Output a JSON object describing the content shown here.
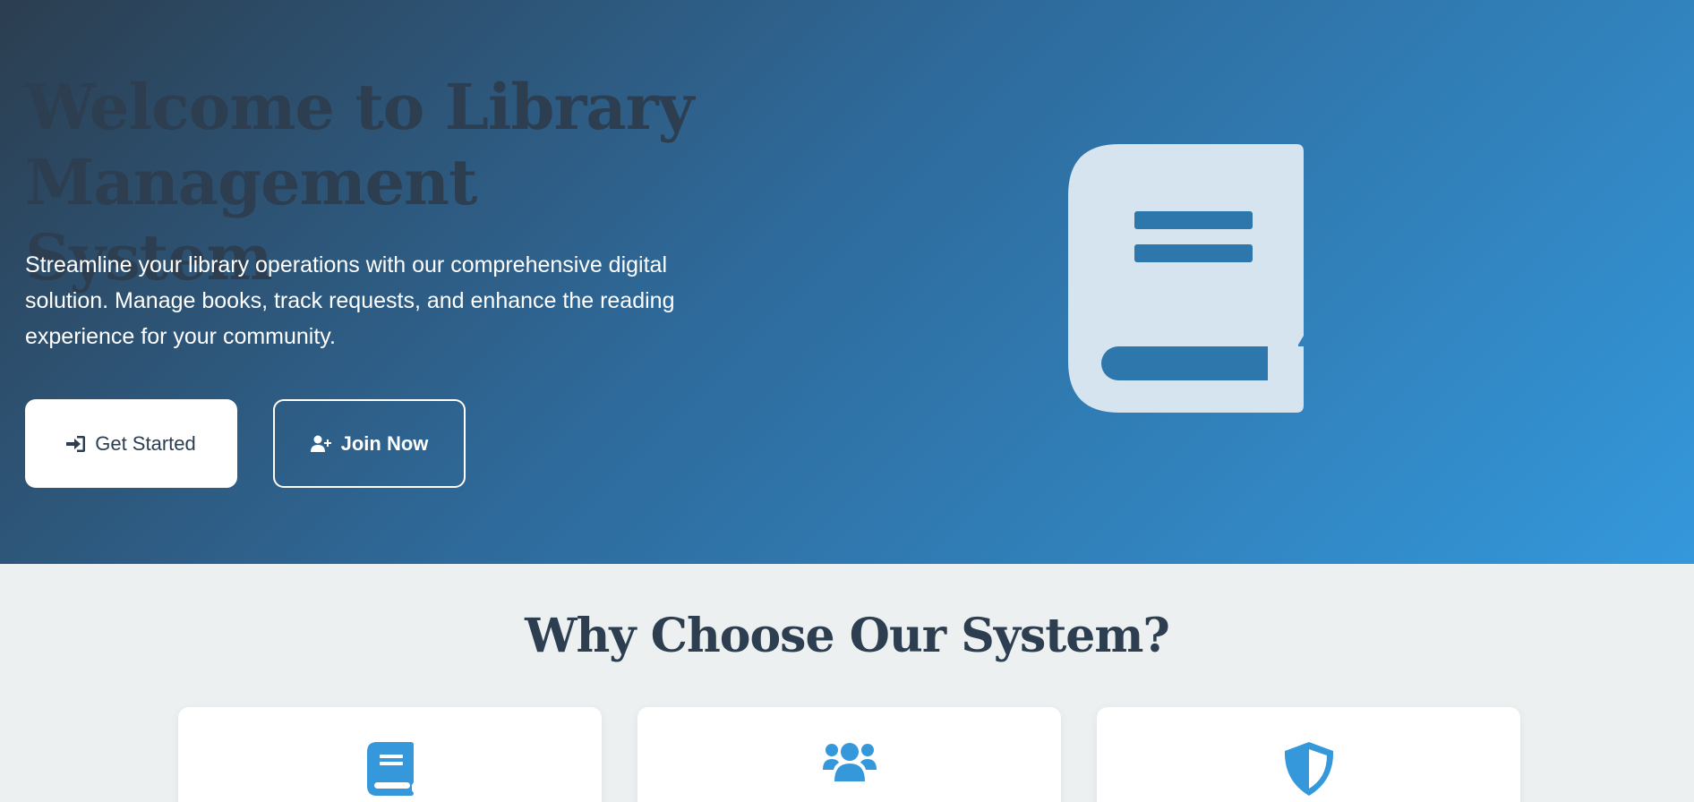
{
  "hero": {
    "title": "Welcome to Library Management System",
    "subtitle": "Streamline your library operations with our comprehensive digital solution. Manage books, track requests, and enhance the reading experience for your community.",
    "get_started_label": "Get Started",
    "join_now_label": "Join Now",
    "illustration_icon": "book-icon"
  },
  "features": {
    "title": "Why Choose Our System?",
    "cards": [
      {
        "icon": "book-icon"
      },
      {
        "icon": "users-icon"
      },
      {
        "icon": "shield-icon"
      }
    ]
  },
  "colors": {
    "primary_dark": "#2c3e50",
    "accent_blue": "#3498db",
    "background": "#ecf0f1",
    "book_illustration": "#d6e4f0"
  }
}
